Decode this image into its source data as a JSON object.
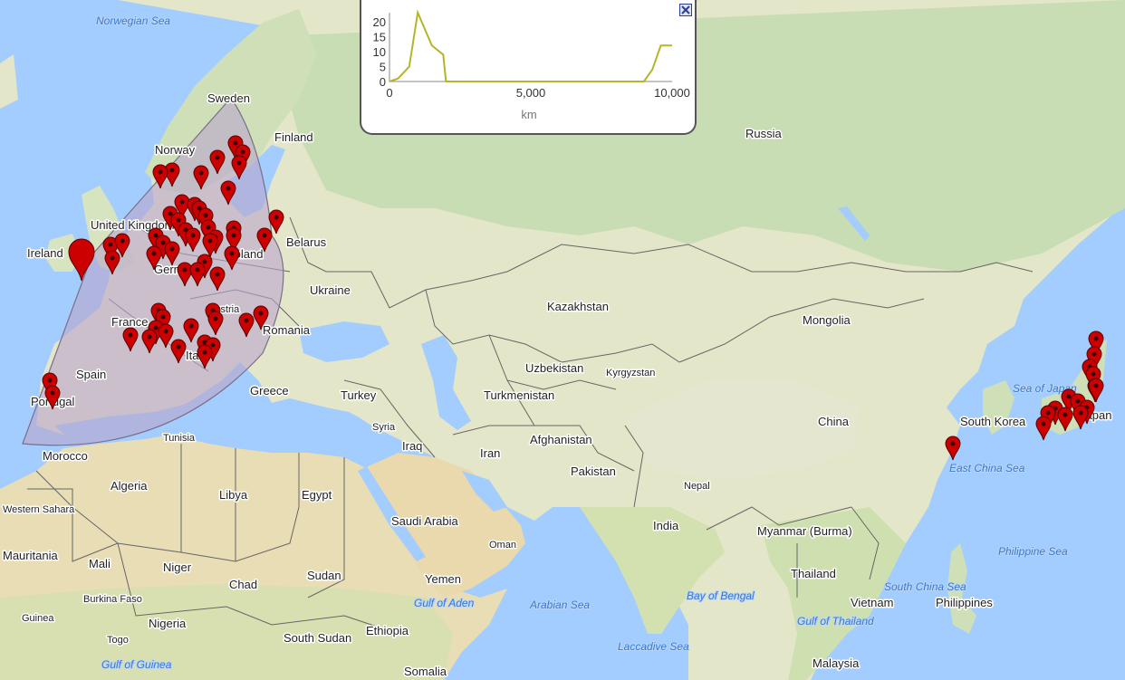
{
  "map": {
    "countries": [
      "Norway",
      "Sweden",
      "Finland",
      "Russia",
      "United Kingdom",
      "Ireland",
      "France",
      "Spain",
      "Portugal",
      "Germany",
      "Poland",
      "Belarus",
      "Ukraine",
      "Austria",
      "Italy",
      "Romania",
      "Greece",
      "Turkey",
      "Syria",
      "Iraq",
      "Iran",
      "Kazakhstan",
      "Uzbekistan",
      "Kyrgyzstan",
      "Turkmenistan",
      "Afghanistan",
      "Pakistan",
      "Mongolia",
      "China",
      "South Korea",
      "Japan",
      "Nepal",
      "India",
      "Myanmar (Burma)",
      "Thailand",
      "Vietnam",
      "Philippines",
      "Malaysia",
      "Morocco",
      "Algeria",
      "Libya",
      "Egypt",
      "Saudi Arabia",
      "Oman",
      "Yemen",
      "Tunisia",
      "Western Sahara",
      "Mauritania",
      "Mali",
      "Niger",
      "Chad",
      "Sudan",
      "South Sudan",
      "Ethiopia",
      "Somalia",
      "Burkina Faso",
      "Nigeria",
      "Guinea",
      "Togo"
    ],
    "seas": [
      "Norwegian Sea",
      "Sea of Japan",
      "East China Sea",
      "Philippine Sea",
      "South China Sea",
      "Bay of Bengal",
      "Arabian Sea",
      "Gulf of Aden",
      "Laccadive Sea",
      "Gulf of Guinea",
      "Gulf of Thailand"
    ],
    "colors": {
      "water": "#a3ccff",
      "land": "#e6e7cf",
      "forest": "#cde2b6",
      "desert": "#e9dcb3",
      "border": "#5c5c5c",
      "marker": "#cc0000",
      "sector_fill": "#b9a5cc",
      "sector_stroke": "#7a6f88"
    }
  },
  "elevation_profile": {
    "close_icon": "close-x-icon",
    "chart_data": {
      "type": "line",
      "x": [
        0,
        300,
        700,
        1000,
        1500,
        1900,
        2000,
        5000,
        8000,
        9000,
        9300,
        9600,
        10000
      ],
      "y": [
        0,
        1,
        5,
        23,
        12,
        9,
        0,
        0,
        0,
        0,
        4,
        12,
        12
      ],
      "xlabel": "km",
      "xlim": [
        0,
        10000
      ],
      "ylim": [
        0,
        23
      ],
      "x_ticks": [
        "0",
        "5,000",
        "10,000"
      ],
      "y_ticks": [
        "0",
        "5",
        "10",
        "15",
        "20"
      ],
      "line_color": "#b5b52a",
      "grid": false
    }
  }
}
